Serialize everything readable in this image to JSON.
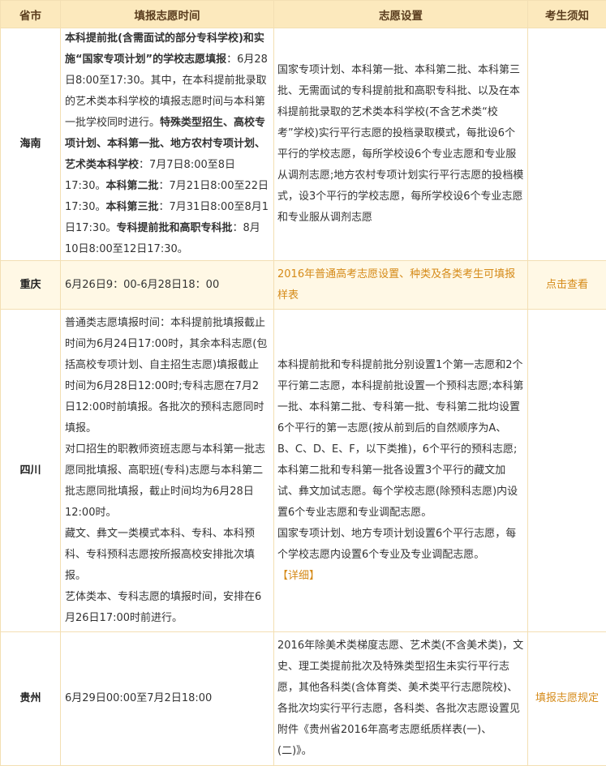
{
  "headers": {
    "province": "省市",
    "time": "填报志愿时间",
    "settings": "志愿设置",
    "notice": "考生须知"
  },
  "rows": [
    {
      "province": "海南",
      "time_segments": [
        {
          "text": "本科提前批(含需面试的部分专科学校)和实施“国家专项计划”的学校志愿填报",
          "bold": true
        },
        {
          "text": "：6月28日8:00至17:30。其中，在本科提前批录取的艺术类本科学校的填报志愿时间与本科第一批学校同时进行。",
          "bold": false
        },
        {
          "text": "特殊类型招生、高校专项计划、本科第一批、地方农村专项计划、艺术类本科学校",
          "bold": true
        },
        {
          "text": "：7月7日8:00至8日17:30。",
          "bold": false
        },
        {
          "text": "本科第二批",
          "bold": true
        },
        {
          "text": "：7月21日8:00至22日17:30。",
          "bold": false
        },
        {
          "text": "本科第三批",
          "bold": true
        },
        {
          "text": "：7月31日8:00至8月1日17:30。",
          "bold": false
        },
        {
          "text": "专科提前批和高职专科批",
          "bold": true
        },
        {
          "text": "：8月10日8:00至12日17:30。",
          "bold": false
        }
      ],
      "settings": "国家专项计划、本科第一批、本科第二批、本科第三批、无需面试的专科提前批和高职专科批、以及在本科提前批录取的艺术类本科学校(不含艺术类“校考”学校)实行平行志愿的投档录取模式，每批设6个平行的学校志愿，每所学校设6个专业志愿和专业服从调剂志愿;地方农村专项计划实行平行志愿的投档模式，设3个平行的学校志愿，每所学校设6个专业志愿和专业服从调剂志愿",
      "notice": ""
    },
    {
      "province": "重庆",
      "time": "6月26日9：00-6月28日18：00",
      "settings_link": "2016年普通高考志愿设置、种类及各类考生可填报样表",
      "notice": "点击查看"
    },
    {
      "province": "四川",
      "time_paras": [
        "普通类志愿填报时间：本科提前批填报截止时间为6月24日17:00时，其余本科志愿(包括高校专项计划、自主招生志愿)填报截止时间为6月28日12:00时;专科志愿在7月2日12:00时前填报。各批次的预科志愿同时填报。",
        "对口招生的职教师资班志愿与本科第一批志愿同批填报、高职班(专科)志愿与本科第二批志愿同批填报，截止时间均为6月28日12:00时。",
        "藏文、彝文一类模式本科、专科、本科预科、专科预科志愿按所报高校安排批次填报。",
        "艺体类本、专科志愿的填报时间，安排在6月26日17:00时前进行。"
      ],
      "settings_paras": [
        "本科提前批和专科提前批分别设置1个第一志愿和2个平行第二志愿，本科提前批设置一个预科志愿;本科第一批、本科第二批、专科第一批、专科第二批均设置6个平行的第一志愿(按从前到后的自然顺序为A、B、C、D、E、F，以下类推)，6个平行的预科志愿;本科第二批和专科第一批各设置3个平行的藏文加试、彝文加试志愿。每个学校志愿(除预科志愿)内设置6个专业志愿和专业调配志愿。",
        "国家专项计划、地方专项计划设置6个平行志愿，每个学校志愿内设置6个专业及专业调配志愿。"
      ],
      "settings_link": "【详细】",
      "notice": ""
    },
    {
      "province": "贵州",
      "time": "6月29日00:00至7月2日18:00",
      "settings": "2016年除美术类梯度志愿、艺术类(不含美术类)，文史、理工类提前批次及特殊类型招生未实行平行志愿，其他各科类(含体育类、美术类平行志愿院校)、各批次均实行平行志愿，各科类、各批次志愿设置见附件《贵州省2016年高考志愿纸质样表(一)、(二)》。",
      "notice": "填报志愿规定"
    }
  ]
}
